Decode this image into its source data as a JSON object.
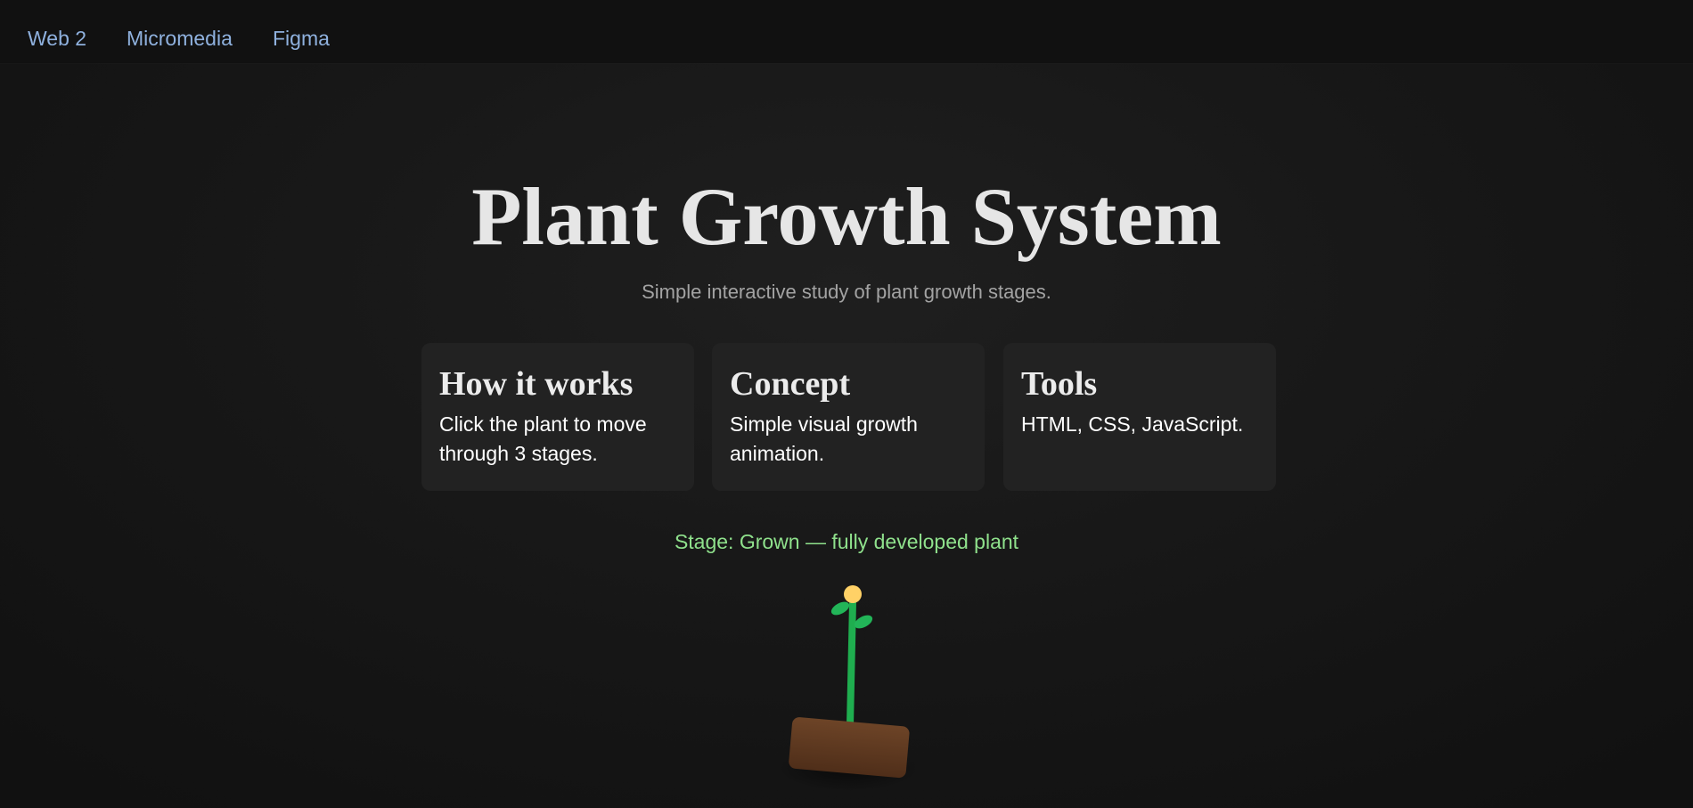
{
  "nav": {
    "items": [
      {
        "label": "Web 2"
      },
      {
        "label": "Micromedia"
      },
      {
        "label": "Figma"
      }
    ]
  },
  "hero": {
    "title": "Plant Growth System",
    "subtitle": "Simple interactive study of plant growth stages."
  },
  "cards": [
    {
      "title": "How it works",
      "body": "Click the plant to move through 3 stages."
    },
    {
      "title": "Concept",
      "body": "Simple visual growth animation."
    },
    {
      "title": "Tools",
      "body": "HTML, CSS, JavaScript."
    }
  ],
  "stage": {
    "text": "Stage: Grown — fully developed plant"
  },
  "colors": {
    "background": "#181818",
    "nav_background": "#111111",
    "nav_link": "#8fb1de",
    "card_background": "#222222",
    "stage_text": "#8fe18c",
    "stem": "#1fae4f",
    "flower": "#ffd166",
    "pot": "#6b3f22"
  }
}
